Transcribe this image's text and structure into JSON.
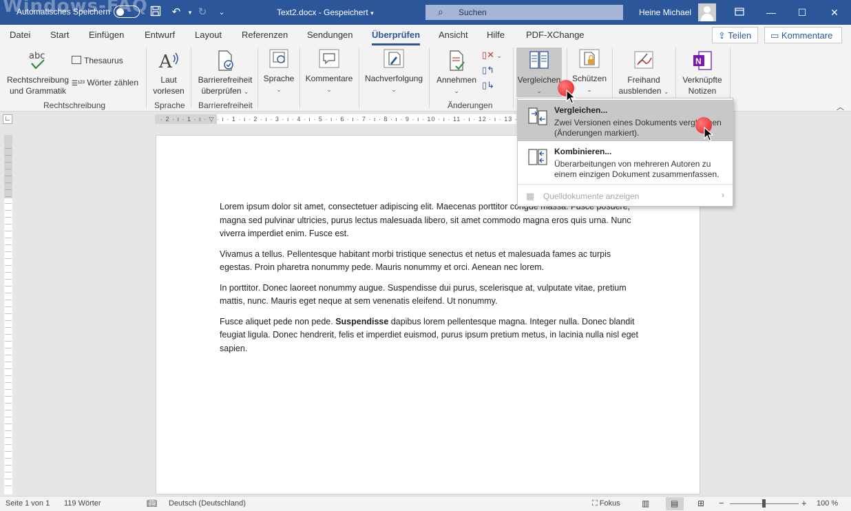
{
  "titlebar": {
    "watermark": "Windows-FAQ",
    "autosave_label": "Automatisches Speichern",
    "document_title": "Text2.docx  -  Gespeichert",
    "search_placeholder": "Suchen",
    "user_name": "Heine Michael"
  },
  "tabs": [
    "Datei",
    "Start",
    "Einfügen",
    "Entwurf",
    "Layout",
    "Referenzen",
    "Sendungen",
    "Überprüfen",
    "Ansicht",
    "Hilfe",
    "PDF-XChange"
  ],
  "active_tab": "Überprüfen",
  "share_label": "Teilen",
  "comments_label": "Kommentare",
  "ribbon": {
    "spelling": "Rechtschreibung",
    "spelling2": "und Grammatik",
    "thesaurus": "Thesaurus",
    "word_count": "Wörter zählen",
    "group_spelling": "Rechtschreibung",
    "read_aloud1": "Laut",
    "read_aloud2": "vorlesen",
    "group_speech": "Sprache",
    "access1": "Barrierefreiheit",
    "access2": "überprüfen",
    "group_access": "Barrierefreiheit",
    "language": "Sprache",
    "comments": "Kommentare",
    "tracking": "Nachverfolgung",
    "accept": "Annehmen",
    "group_changes": "Änderungen",
    "compare": "Vergleichen",
    "protect": "Schützen",
    "ink1": "Freihand",
    "ink2": "ausblenden",
    "linked1": "Verknüpfte",
    "linked2": "Notizen"
  },
  "dropdown": {
    "compare_title": "Vergleichen...",
    "compare_desc": "Zwei Versionen eines Dokuments vergleichen (Änderungen markiert).",
    "combine_title": "Kombinieren...",
    "combine_desc": "Überarbeitungen von mehreren Autoren zu einem einzigen Dokument zusammenfassen.",
    "source_docs": "Quelldokumente anzeigen"
  },
  "document": {
    "p1": "Lorem ipsum dolor sit amet, consectetuer adipiscing elit. Maecenas porttitor congue massa. Fusce posuere, magna sed pulvinar ultricies, purus lectus malesuada libero, sit amet commodo magna eros quis urna. Nunc viverra imperdiet enim. Fusce est.",
    "p2": "Vivamus a tellus. Pellentesque habitant morbi tristique senectus et netus et malesuada fames ac turpis egestas. Proin pharetra nonummy pede. Mauris nonummy et orci. Aenean nec lorem.",
    "p3": "In porttitor. Donec laoreet nonummy augue. Suspendisse dui purus, scelerisque at, vulputate vitae, pretium mattis, nunc. Mauris eget neque at sem venenatis eleifend. Ut nonummy.",
    "p4_before": "Fusce aliquet pede non pede. ",
    "p4_bold": "Suspendisse",
    "p4_after": " dapibus lorem pellentesque magna. Integer nulla. Donec blandit feugiat ligula. Donec hendrerit, felis et imperdiet euismod, purus ipsum pretium metus, in lacinia nulla nisl eget sapien."
  },
  "ruler_ticks": "· 2 · ı · 1 · ı · ▽ · ı · 1 · ı · 2 · ı · 3 · ı · 4 · ı · 5 · ı · 6 · ı · 7 · ı · 8 · ı · 9 · ı · 10 · ı · 11 · ı · 12 · ı · 13 · ı · 14",
  "statusbar": {
    "page": "Seite 1 von 1",
    "words": "119 Wörter",
    "language": "Deutsch (Deutschland)",
    "focus": "Fokus",
    "zoom": "100 %"
  },
  "colors": {
    "brand": "#2b579a",
    "cursor_dot": "#e01b1b"
  }
}
